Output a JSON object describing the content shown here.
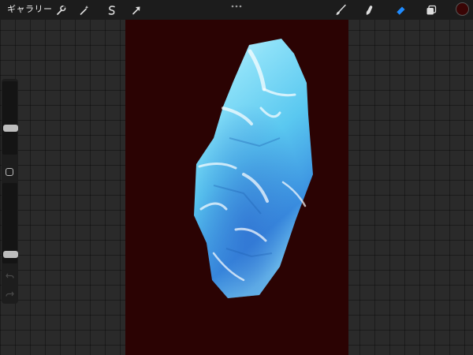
{
  "topbar": {
    "gallery_label": "ギャラリー",
    "left_tools": [
      {
        "name": "actions",
        "icon": "wrench-icon"
      },
      {
        "name": "adjustments",
        "icon": "magic-wand-icon"
      },
      {
        "name": "selection",
        "icon": "selection-s-icon"
      },
      {
        "name": "transform",
        "icon": "arrow-cursor-icon"
      }
    ],
    "more_menu_icon": "more-dots-icon",
    "right_tools": [
      {
        "name": "brush",
        "icon": "brush-icon",
        "active": false
      },
      {
        "name": "smudge",
        "icon": "smudge-icon",
        "active": false
      },
      {
        "name": "eraser",
        "icon": "eraser-icon",
        "active": true
      },
      {
        "name": "layers",
        "icon": "layers-icon",
        "active": false
      }
    ],
    "current_color": "#3a0505"
  },
  "sidebar": {
    "brush_size_level": 0.35,
    "opacity_level": 0.08,
    "undo_icon": "undo-icon",
    "redo_icon": "redo-icon"
  },
  "canvas": {
    "background_color": "#2b0303",
    "subject": "crystal-drawing",
    "accent_color": "#5ac8f0"
  },
  "colors": {
    "active_tool": "#1f8bff",
    "topbar_bg": "#1c1c1c",
    "workspace_bg": "#2a2a2a"
  }
}
